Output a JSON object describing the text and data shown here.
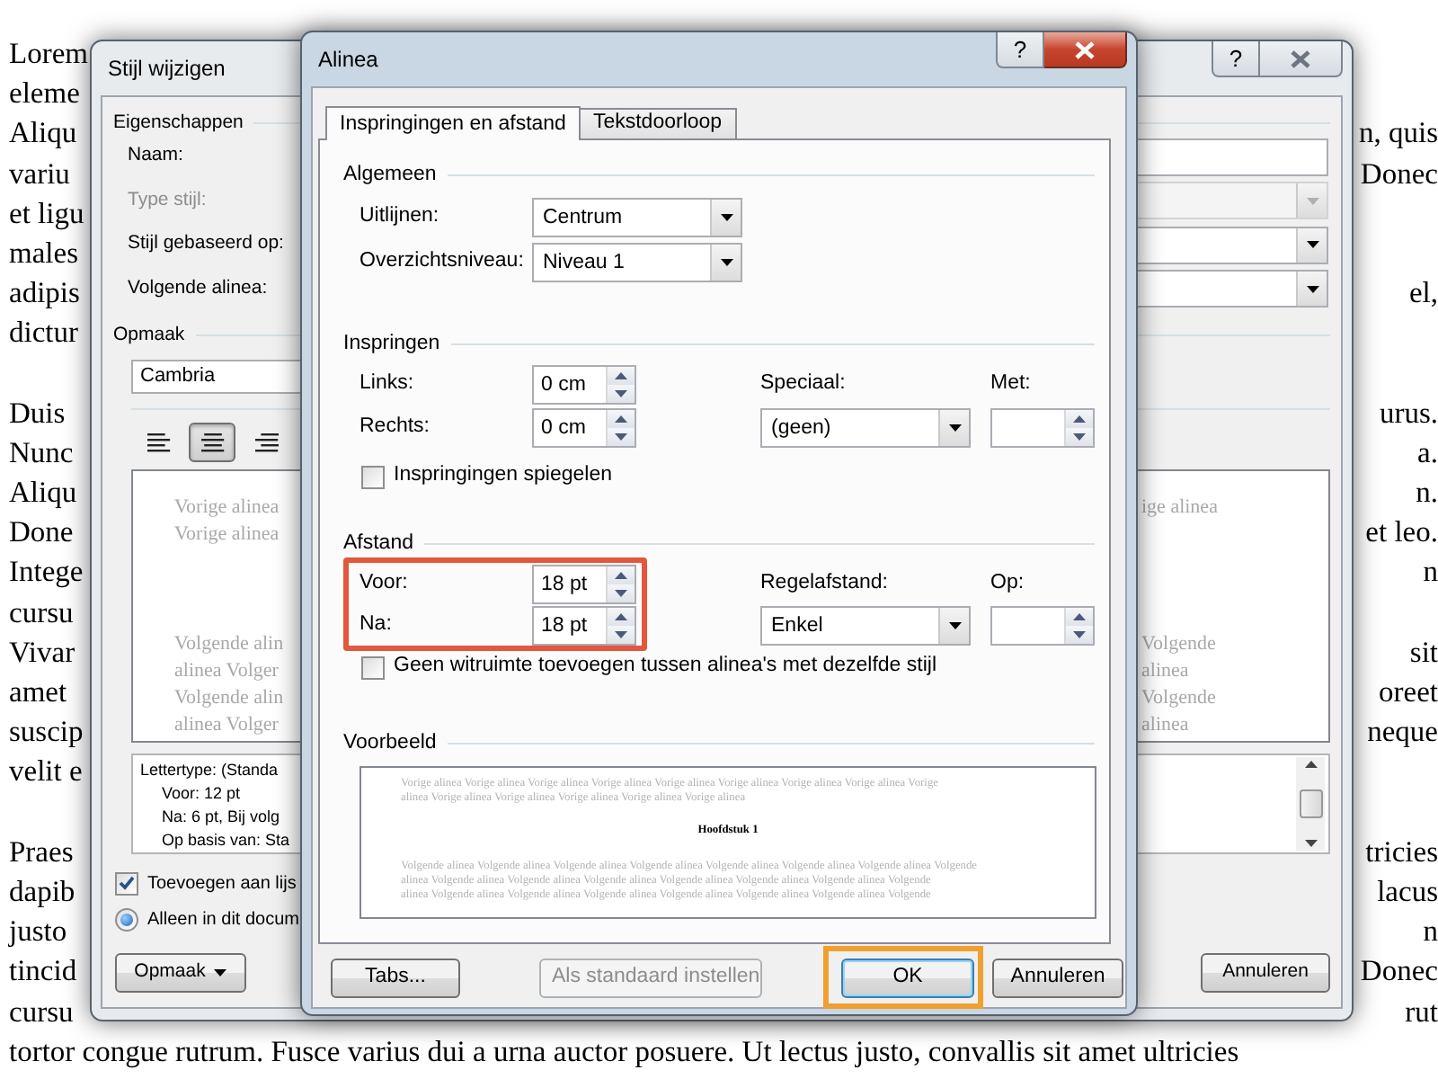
{
  "document": {
    "paragraphs": [
      [
        {
          "left": "Lorem"
        },
        {
          "left": "eleme"
        },
        {
          "left": "Aliqu",
          "right": "n, quis"
        },
        {
          "left": "variu",
          "right": "Donec"
        },
        {
          "left": "et ligu"
        },
        {
          "left": "males"
        },
        {
          "left": "adipis",
          "right": "el,"
        },
        {
          "left": "dictur"
        }
      ],
      [
        {
          "left": "Duis",
          "right": "urus."
        },
        {
          "left": "Nunc",
          "right": "a."
        },
        {
          "left": "Aliqu",
          "right": "n."
        },
        {
          "left": "Done",
          "right": "et leo."
        },
        {
          "left": "Intege",
          "right": "n"
        },
        {
          "left": "cursu"
        },
        {
          "left": "Vivar",
          "right": "sit"
        },
        {
          "left": "amet",
          "right": "oreet"
        },
        {
          "left": "suscip",
          "right": "neque"
        },
        {
          "left": "velit e"
        }
      ],
      [
        {
          "left": "Praes",
          "right": "tricies"
        },
        {
          "left": "dapib",
          "right": "lacus"
        },
        {
          "left": "justo",
          "right": "n"
        },
        {
          "left": "tincid",
          "right": "Donec"
        },
        {
          "left": "cursu",
          "right": "rut"
        },
        {
          "left": "tortor congue rutrum. Fusce varius dui a urna auctor posuere. Ut lectus justo, convallis sit amet ultricies"
        }
      ]
    ]
  },
  "style_dialog": {
    "title": "Stijl wijzigen",
    "help_label": "?",
    "properties": {
      "heading": "Eigenschappen",
      "rows": [
        {
          "label": "Naam:",
          "kind": "input",
          "disabled": false
        },
        {
          "label": "Type stijl:",
          "kind": "select",
          "disabled": true
        },
        {
          "label": "Stijl gebaseerd op:",
          "kind": "select",
          "disabled": false
        },
        {
          "label": "Volgende alinea:",
          "kind": "select",
          "disabled": false
        }
      ]
    },
    "format": {
      "heading": "Opmaak",
      "font": "Cambria",
      "alignments": [
        {
          "kind": "left",
          "selected": false
        },
        {
          "kind": "center",
          "selected": true
        },
        {
          "kind": "right",
          "selected": false
        }
      ],
      "preview": {
        "previous_lines": [
          {
            "left": "Vorige alinea",
            "right": "ige alinea"
          },
          {
            "left": "Vorige alinea"
          }
        ],
        "next_lines": [
          {
            "left": "Volgende alin",
            "right": "Volgende"
          },
          {
            "left": "alinea Volger",
            "right": "alinea"
          },
          {
            "left": "Volgende alin",
            "right": "Volgende"
          },
          {
            "left": "alinea Volger",
            "right": "alinea"
          }
        ]
      }
    },
    "description": {
      "heading": "Lettertype: (Standa",
      "lines": [
        "Voor:  12 pt",
        "Na:  6 pt, Bij volg",
        "Op basis van: Sta"
      ]
    },
    "add_to_list": {
      "label": "Toevoegen aan lijs",
      "checked": true
    },
    "scope_options": [
      {
        "label": "Alleen in dit docum",
        "selected": true
      }
    ],
    "format_button": "Opmaak",
    "cancel_button": "Annuleren"
  },
  "paragraph_dialog": {
    "title": "Alinea",
    "help_label": "?",
    "tabs": [
      {
        "label": "Inspringingen en afstand",
        "selected": true
      },
      {
        "label": "Tekstdoorloop",
        "selected": false
      }
    ],
    "general": {
      "heading": "Algemeen",
      "rows": [
        {
          "label": "Uitlijnen:",
          "value": "Centrum"
        },
        {
          "label": "Overzichtsniveau:",
          "value": "Niveau 1"
        }
      ]
    },
    "indentation": {
      "heading": "Inspringen",
      "rows": [
        {
          "label": "Links:",
          "value": "0 cm"
        },
        {
          "label": "Rechts:",
          "value": "0 cm"
        }
      ],
      "special": {
        "label": "Speciaal:",
        "value": "(geen)"
      },
      "by": {
        "label": "Met:"
      },
      "mirror": {
        "label": "Inspringingen spiegelen",
        "checked": false
      }
    },
    "spacing": {
      "heading": "Afstand",
      "highlighted": true,
      "rows": [
        {
          "label": "Voor:",
          "value": "18 pt"
        },
        {
          "label": "Na:",
          "value": "18 pt"
        }
      ],
      "line_spacing": {
        "label": "Regelafstand:",
        "value": "Enkel"
      },
      "at": {
        "label": "Op:"
      },
      "no_space": {
        "label": "Geen witruimte toevoegen tussen alinea's met dezelfde stijl",
        "checked": false
      }
    },
    "preview": {
      "heading": "Voorbeeld",
      "previous_lines": [
        "Vorige alinea Vorige alinea Vorige alinea Vorige alinea Vorige alinea Vorige alinea Vorige alinea Vorige alinea Vorige",
        "alinea Vorige alinea Vorige alinea Vorige alinea Vorige alinea Vorige alinea"
      ],
      "sample": "Hoofdstuk 1",
      "next_lines": [
        "Volgende alinea Volgende alinea Volgende alinea Volgende alinea Volgende alinea Volgende alinea Volgende alinea Volgende",
        "alinea Volgende alinea Volgende alinea Volgende alinea Volgende alinea Volgende alinea Volgende alinea Volgende",
        "alinea Volgende alinea Volgende alinea Volgende alinea Volgende alinea Volgende alinea Volgende alinea Volgende"
      ]
    },
    "buttons": [
      {
        "label": "Tabs...",
        "disabled": false,
        "default": false,
        "highlighted": false
      },
      {
        "label": "Als standaard instellen",
        "disabled": true,
        "default": false,
        "highlighted": false
      },
      {
        "label": "OK",
        "disabled": false,
        "default": true,
        "highlighted": true
      },
      {
        "label": "Annuleren",
        "disabled": false,
        "default": false,
        "highlighted": false
      }
    ]
  }
}
